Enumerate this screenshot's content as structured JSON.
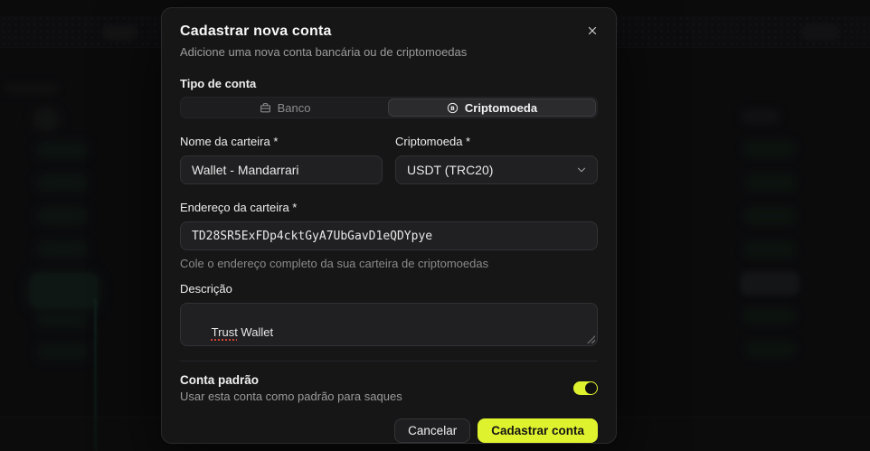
{
  "modal": {
    "title": "Cadastrar nova conta",
    "subtitle": "Adicione uma nova conta bancária ou de criptomoedas",
    "account_type": {
      "label": "Tipo de conta",
      "tabs": [
        {
          "label": "Banco",
          "icon": "briefcase-icon",
          "selected": false
        },
        {
          "label": "Criptomoeda",
          "icon": "bitcoin-icon",
          "selected": true
        }
      ]
    },
    "fields": {
      "wallet_name": {
        "label": "Nome da carteira *",
        "value": "Wallet - Mandarrari"
      },
      "crypto": {
        "label": "Criptomoeda *",
        "value": "USDT (TRC20)",
        "icon": "chevron-down-icon"
      },
      "address": {
        "label": "Endereço da carteira *",
        "value": "TD28SR5ExFDp4cktGyA7UbGavD1eQDYpye",
        "helper": "Cole o endereço completo da sua carteira de criptomoedas"
      },
      "description": {
        "label": "Descrição",
        "misspelled_word": "Trust",
        "rest": " Wallet"
      }
    },
    "default_account": {
      "title": "Conta padrão",
      "subtitle": "Usar esta conta como padrão para saques",
      "enabled": true
    },
    "actions": {
      "cancel": "Cancelar",
      "submit": "Cadastrar conta"
    },
    "close_icon": "close-icon"
  },
  "colors": {
    "accent": "#dff22e",
    "accent_text": "#141414",
    "modal_bg": "#161617",
    "input_bg": "#202022",
    "text_primary": "#f2f2f2",
    "text_secondary": "#9c9c9c"
  }
}
